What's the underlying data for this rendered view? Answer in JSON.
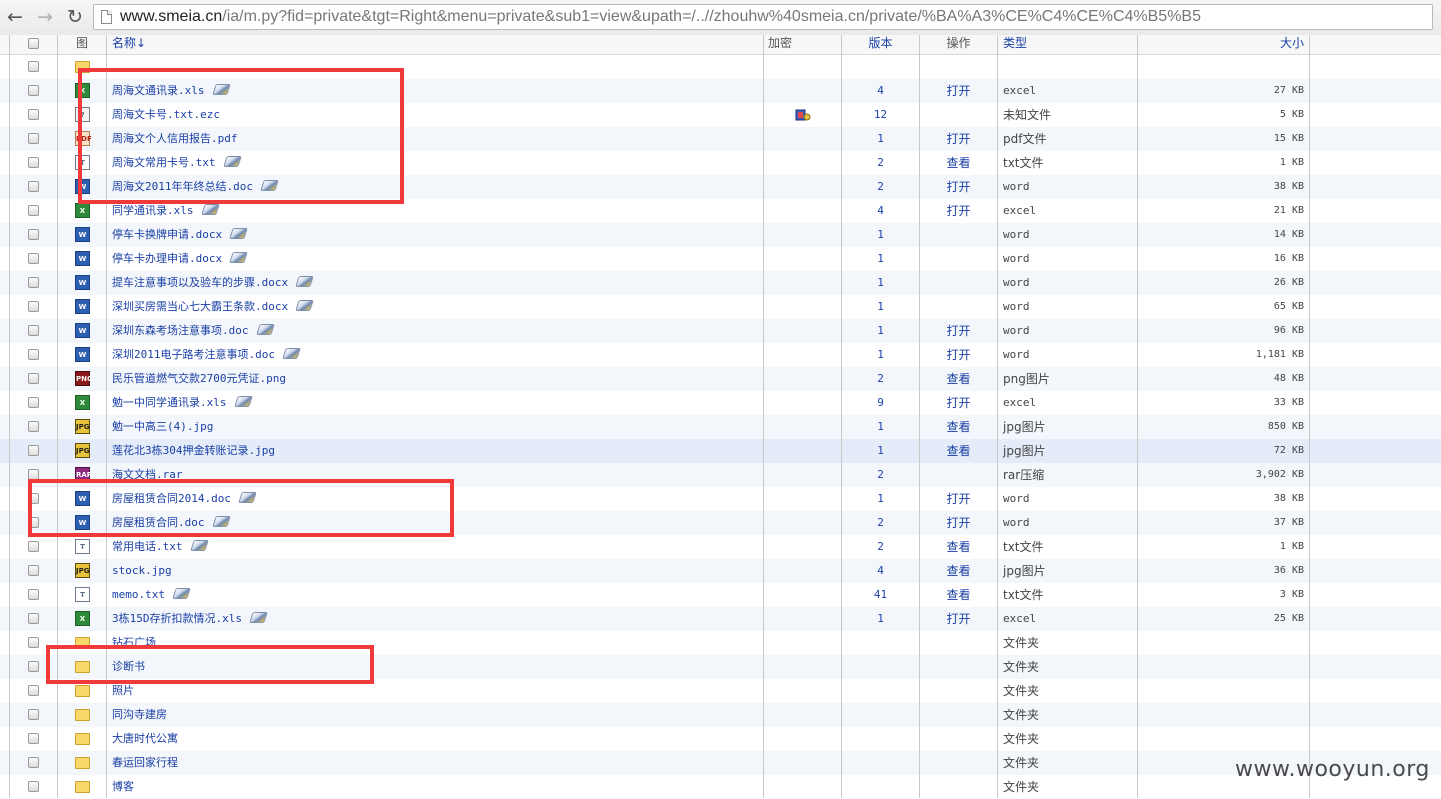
{
  "browser": {
    "url_host": "www.smeia.cn",
    "url_rest": "/ia/m.py?fid=private&tgt=Right&menu=private&sub1=view&upath=/..//zhouhw%40smeia.cn/private/%BA%A3%CE%C4%CE%C4%B5%B5"
  },
  "columns": {
    "icon": "图",
    "name": "名称↓",
    "encrypt": "加密",
    "version": "版本",
    "action": "操作",
    "type": "类型",
    "size": "大小"
  },
  "rows": [
    {
      "name": "",
      "icon": "folder",
      "pen": false,
      "version": "",
      "action": "",
      "type": "",
      "size": ""
    },
    {
      "name": "周海文通讯录.xls",
      "icon": "excel",
      "pen": true,
      "version": "4",
      "action": "打开",
      "type": "excel",
      "size": "27 KB"
    },
    {
      "name": "周海文卡号.txt.ezc",
      "icon": "unknown",
      "pen": false,
      "encrypted": true,
      "version": "12",
      "action": "",
      "type": "未知文件",
      "size": "5 KB"
    },
    {
      "name": "周海文个人信用报告.pdf",
      "icon": "pdf",
      "pen": false,
      "version": "1",
      "action": "打开",
      "type": "pdf文件",
      "size": "15 KB"
    },
    {
      "name": "周海文常用卡号.txt",
      "icon": "txt",
      "pen": true,
      "version": "2",
      "action": "查看",
      "type": "txt文件",
      "size": "1 KB"
    },
    {
      "name": "周海文2011年年终总结.doc",
      "icon": "word",
      "pen": true,
      "version": "2",
      "action": "打开",
      "type": "word",
      "size": "38 KB"
    },
    {
      "name": "同学通讯录.xls",
      "icon": "excel",
      "pen": true,
      "version": "4",
      "action": "打开",
      "type": "excel",
      "size": "21 KB"
    },
    {
      "name": "停车卡换牌申请.docx",
      "icon": "word",
      "pen": true,
      "version": "1",
      "action": "",
      "type": "word",
      "size": "14 KB"
    },
    {
      "name": "停车卡办理申请.docx",
      "icon": "word",
      "pen": true,
      "version": "1",
      "action": "",
      "type": "word",
      "size": "16 KB"
    },
    {
      "name": "提车注意事项以及验车的步骤.docx",
      "icon": "word",
      "pen": true,
      "version": "1",
      "action": "",
      "type": "word",
      "size": "26 KB"
    },
    {
      "name": "深圳买房需当心七大霸王条款.docx",
      "icon": "word",
      "pen": true,
      "version": "1",
      "action": "",
      "type": "word",
      "size": "65 KB"
    },
    {
      "name": "深圳东森考场注意事项.doc",
      "icon": "word",
      "pen": true,
      "version": "1",
      "action": "打开",
      "type": "word",
      "size": "96 KB"
    },
    {
      "name": "深圳2011电子路考注意事项.doc",
      "icon": "word",
      "pen": true,
      "version": "1",
      "action": "打开",
      "type": "word",
      "size": "1,181 KB"
    },
    {
      "name": "民乐管道燃气交款2700元凭证.png",
      "icon": "png",
      "pen": false,
      "version": "2",
      "action": "查看",
      "type": "png图片",
      "size": "48 KB"
    },
    {
      "name": "勉一中同学通讯录.xls",
      "icon": "excel",
      "pen": true,
      "version": "9",
      "action": "打开",
      "type": "excel",
      "size": "33 KB"
    },
    {
      "name": "勉一中高三(4).jpg",
      "icon": "jpg",
      "pen": false,
      "version": "1",
      "action": "查看",
      "type": "jpg图片",
      "size": "850 KB"
    },
    {
      "name": "莲花北3栋304押金转账记录.jpg",
      "icon": "jpg",
      "pen": false,
      "version": "1",
      "action": "查看",
      "type": "jpg图片",
      "size": "72 KB"
    },
    {
      "name": "海文文档.rar",
      "icon": "rar",
      "pen": false,
      "version": "2",
      "action": "",
      "type": "rar压缩",
      "size": "3,902 KB"
    },
    {
      "name": "房屋租赁合同2014.doc",
      "icon": "word",
      "pen": true,
      "version": "1",
      "action": "打开",
      "type": "word",
      "size": "38 KB"
    },
    {
      "name": "房屋租赁合同.doc",
      "icon": "word",
      "pen": true,
      "version": "2",
      "action": "打开",
      "type": "word",
      "size": "37 KB"
    },
    {
      "name": "常用电话.txt",
      "icon": "txt",
      "pen": true,
      "version": "2",
      "action": "查看",
      "type": "txt文件",
      "size": "1 KB"
    },
    {
      "name": "stock.jpg",
      "icon": "jpg",
      "pen": false,
      "version": "4",
      "action": "查看",
      "type": "jpg图片",
      "size": "36 KB"
    },
    {
      "name": "memo.txt",
      "icon": "txt",
      "pen": true,
      "version": "41",
      "action": "查看",
      "type": "txt文件",
      "size": "3 KB"
    },
    {
      "name": "3栋15D存折扣款情况.xls",
      "icon": "excel",
      "pen": true,
      "version": "1",
      "action": "打开",
      "type": "excel",
      "size": "25 KB"
    },
    {
      "name": "钻石广场",
      "icon": "folder",
      "pen": false,
      "version": "",
      "action": "",
      "type": "文件夹",
      "size": ""
    },
    {
      "name": "诊断书",
      "icon": "folder",
      "pen": false,
      "version": "",
      "action": "",
      "type": "文件夹",
      "size": ""
    },
    {
      "name": "照片",
      "icon": "folder",
      "pen": false,
      "version": "",
      "action": "",
      "type": "文件夹",
      "size": ""
    },
    {
      "name": "同沟寺建房",
      "icon": "folder",
      "pen": false,
      "version": "",
      "action": "",
      "type": "文件夹",
      "size": ""
    },
    {
      "name": "大唐时代公寓",
      "icon": "folder",
      "pen": false,
      "version": "",
      "action": "",
      "type": "文件夹",
      "size": ""
    },
    {
      "name": "春运回家行程",
      "icon": "folder",
      "pen": false,
      "version": "",
      "action": "",
      "type": "文件夹",
      "size": ""
    },
    {
      "name": "博客",
      "icon": "folder",
      "pen": false,
      "version": "",
      "action": "",
      "type": "文件夹",
      "size": ""
    }
  ],
  "highlight_color": "#f03a3a",
  "watermark": "www.wooyun.org"
}
